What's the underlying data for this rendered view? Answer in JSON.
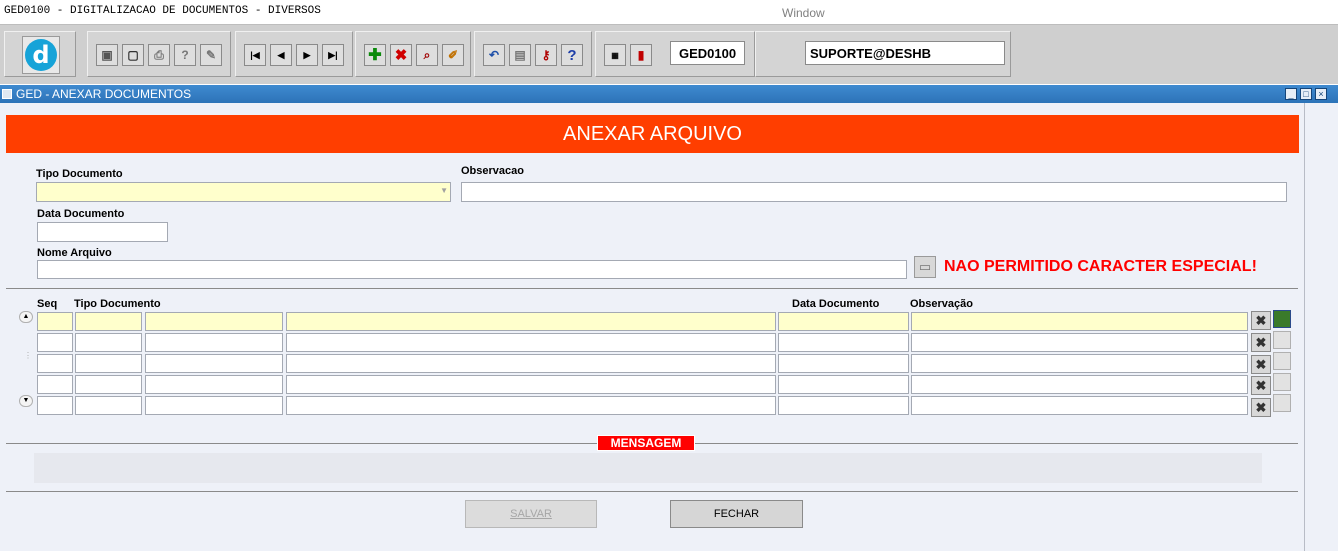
{
  "titlebar": {
    "app_title": "GED0100 - DIGITALIZACAO DE DOCUMENTOS - DIVERSOS",
    "window_menu": "Window"
  },
  "toolbar": {
    "logo_letter": "d",
    "program_code": "GED0100",
    "user": "SUPORTE@DESHB",
    "buttons": [
      "save-icon",
      "window-icon",
      "print-icon",
      "help-query-icon",
      "edit-icon",
      "first-record-icon",
      "prev-record-icon",
      "next-record-icon",
      "last-record-icon",
      "insert-record-icon",
      "delete-record-icon",
      "query-icon",
      "clear-icon",
      "undo-icon",
      "paste-icon",
      "key-icon",
      "help-icon",
      "menu-icon",
      "exit-icon"
    ]
  },
  "form": {
    "title": "GED - ANEXAR DOCUMENTOS",
    "banner": "ANEXAR ARQUIVO",
    "fields": {
      "tipo_documento_label": "Tipo Documento",
      "observacao_label": "Observacao",
      "data_documento_label": "Data Documento",
      "nome_arquivo_label": "Nome Arquivo"
    },
    "warning": "NAO PERMITIDO CARACTER ESPECIAL!"
  },
  "grid": {
    "headers": {
      "seq": "Seq",
      "tipo_documento": "Tipo Documento",
      "data_documento": "Data Documento",
      "observacao": "Observação"
    },
    "rows": [
      {
        "seq": "",
        "tipo": "",
        "desc": "",
        "doc": "",
        "data": "",
        "obs": ""
      },
      {
        "seq": "",
        "tipo": "",
        "desc": "",
        "doc": "",
        "data": "",
        "obs": ""
      },
      {
        "seq": "",
        "tipo": "",
        "desc": "",
        "doc": "",
        "data": "",
        "obs": ""
      },
      {
        "seq": "",
        "tipo": "",
        "desc": "",
        "doc": "",
        "data": "",
        "obs": ""
      },
      {
        "seq": "",
        "tipo": "",
        "desc": "",
        "doc": "",
        "data": "",
        "obs": ""
      }
    ]
  },
  "message": {
    "label": "MENSAGEM",
    "text": ""
  },
  "buttons": {
    "salvar": "SALVAR",
    "fechar": "FECHAR"
  },
  "colors": {
    "banner": "#ff3e00",
    "form_titlebar": "#3f8ad0",
    "current_row": "#ffffcc",
    "warning": "#ff0000"
  }
}
